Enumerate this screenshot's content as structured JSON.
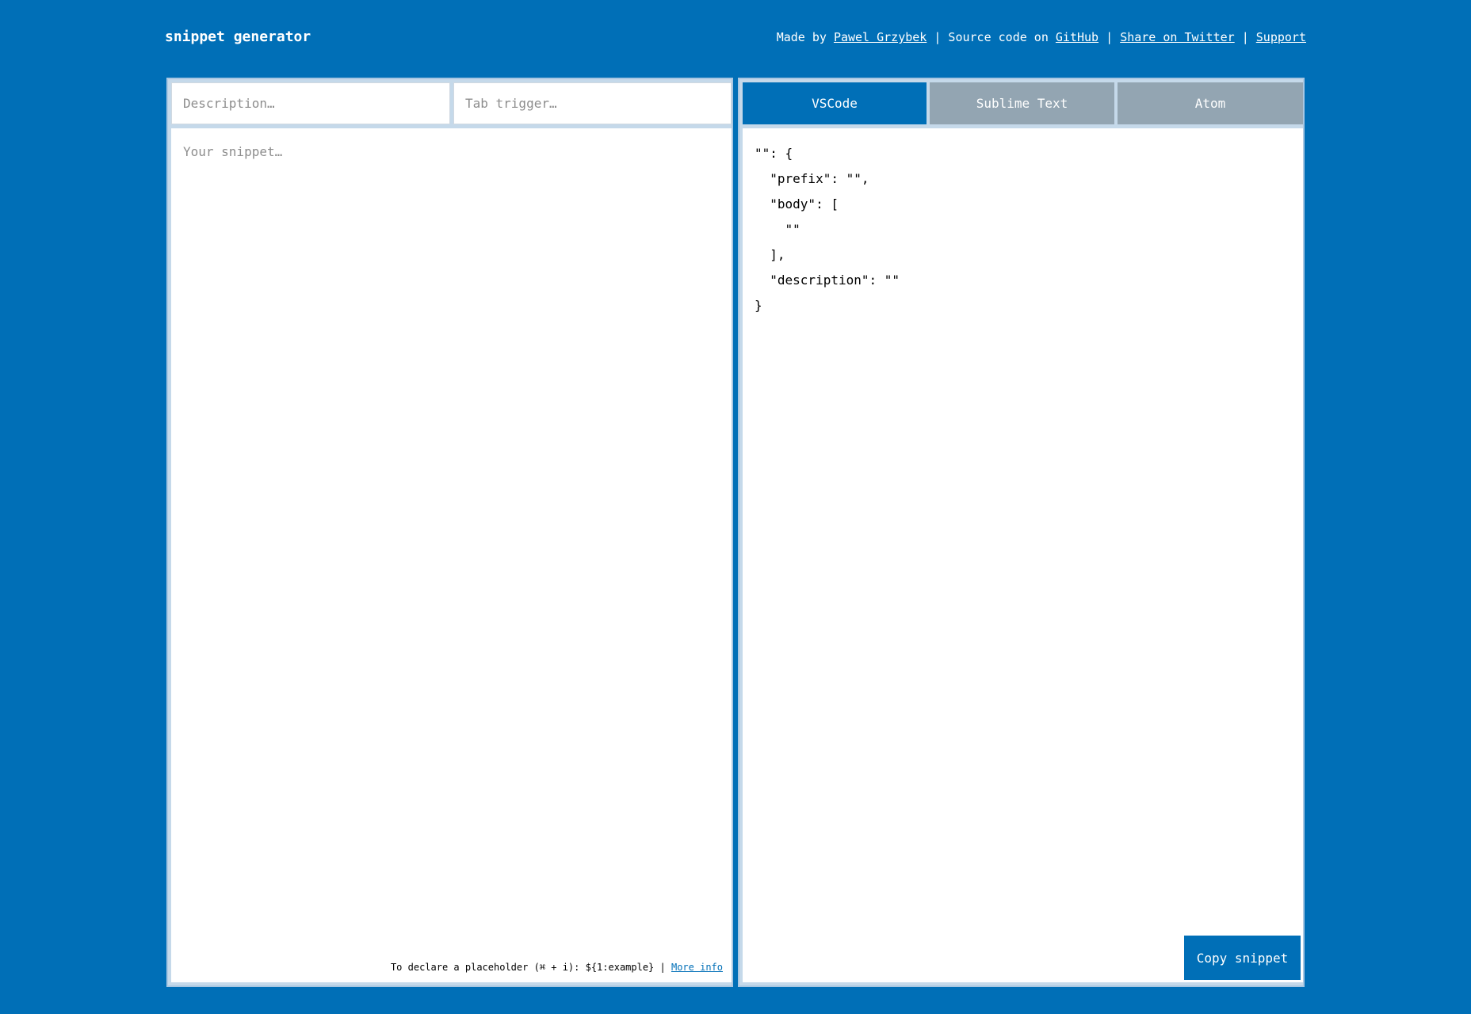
{
  "header": {
    "title": "snippet generator",
    "made_by_prefix": "Made by ",
    "author": "Pawel Grzybek",
    "sep1": " | Source code on ",
    "github": "GitHub",
    "sep2": " | ",
    "twitter": "Share on Twitter",
    "sep3": " | ",
    "support": "Support"
  },
  "inputs": {
    "description_placeholder": "Description…",
    "description_value": "",
    "tab_trigger_placeholder": "Tab trigger…",
    "tab_trigger_value": "",
    "snippet_placeholder": "Your snippet…",
    "snippet_value": ""
  },
  "hint": {
    "text": "To declare a placeholder (⌘ + i): ${1:example} | ",
    "link": "More info"
  },
  "tabs": [
    {
      "label": "VSCode",
      "active": true
    },
    {
      "label": "Sublime Text",
      "active": false
    },
    {
      "label": "Atom",
      "active": false
    }
  ],
  "output": {
    "code": "\"\": {\n  \"prefix\": \"\",\n  \"body\": [\n    \"\"\n  ],\n  \"description\": \"\"\n}"
  },
  "copy_button": {
    "label": "Copy snippet"
  },
  "colors": {
    "background": "#006fb7",
    "active_tab": "#006fb7",
    "inactive_tab": "#93a5b2",
    "panel_border": "#c5d9ea"
  }
}
